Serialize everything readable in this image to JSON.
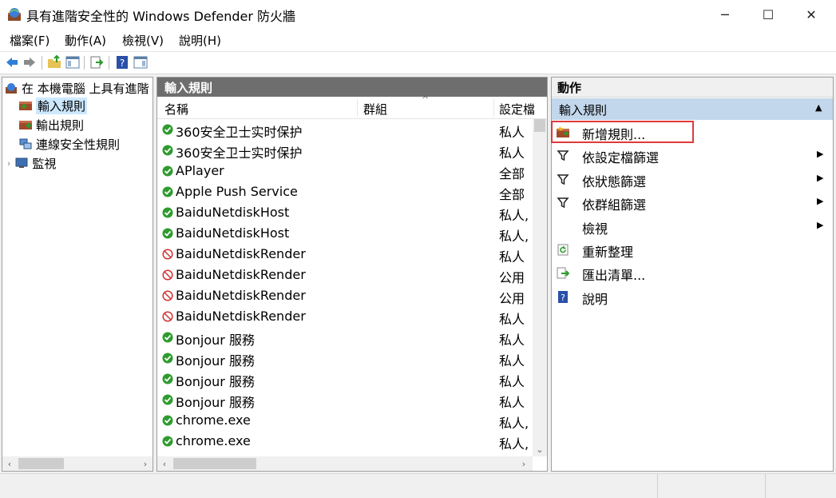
{
  "window": {
    "title": "具有進階安全性的 Windows Defender 防火牆",
    "minimize": "─",
    "maximize": "☐",
    "close": "✕"
  },
  "menu": [
    "檔案(F)",
    "動作(A)",
    "檢視(V)",
    "說明(H)"
  ],
  "tree": {
    "root": "在 本機電腦 上具有進階",
    "items": [
      "輸入規則",
      "輸出規則",
      "連線安全性規則",
      "監視"
    ]
  },
  "middle": {
    "header": "輸入規則",
    "columns": [
      "名稱",
      "群組",
      "設定檔"
    ],
    "rows": [
      {
        "name": "360安全卫士实时保护",
        "profile": "私人",
        "status": "allow"
      },
      {
        "name": "360安全卫士实时保护",
        "profile": "私人",
        "status": "allow"
      },
      {
        "name": "APlayer",
        "profile": "全部",
        "status": "allow"
      },
      {
        "name": "Apple Push Service",
        "profile": "全部",
        "status": "allow"
      },
      {
        "name": "BaiduNetdiskHost",
        "profile": "私人,",
        "status": "allow"
      },
      {
        "name": "BaiduNetdiskHost",
        "profile": "私人,",
        "status": "allow"
      },
      {
        "name": "BaiduNetdiskRender",
        "profile": "私人",
        "status": "block"
      },
      {
        "name": "BaiduNetdiskRender",
        "profile": "公用",
        "status": "block"
      },
      {
        "name": "BaiduNetdiskRender",
        "profile": "公用",
        "status": "block"
      },
      {
        "name": "BaiduNetdiskRender",
        "profile": "私人",
        "status": "block"
      },
      {
        "name": "Bonjour 服務",
        "profile": "私人",
        "status": "allow"
      },
      {
        "name": "Bonjour 服務",
        "profile": "私人",
        "status": "allow"
      },
      {
        "name": "Bonjour 服務",
        "profile": "私人",
        "status": "allow"
      },
      {
        "name": "Bonjour 服務",
        "profile": "私人",
        "status": "allow"
      },
      {
        "name": "chrome.exe",
        "profile": "私人,",
        "status": "allow"
      },
      {
        "name": "chrome.exe",
        "profile": "私人,",
        "status": "allow"
      }
    ]
  },
  "actions": {
    "header": "動作",
    "section": "輸入規則",
    "items": [
      {
        "label": "新增規則...",
        "icon": "new-rule-icon",
        "arrow": false
      },
      {
        "label": "依設定檔篩選",
        "icon": "filter-icon",
        "arrow": true
      },
      {
        "label": "依狀態篩選",
        "icon": "filter-icon",
        "arrow": true
      },
      {
        "label": "依群組篩選",
        "icon": "filter-icon",
        "arrow": true
      },
      {
        "label": "檢視",
        "icon": "",
        "arrow": true
      },
      {
        "label": "重新整理",
        "icon": "refresh-icon",
        "arrow": false
      },
      {
        "label": "匯出清單...",
        "icon": "export-icon",
        "arrow": false
      },
      {
        "label": "說明",
        "icon": "help-icon",
        "arrow": false
      }
    ]
  },
  "colors": {
    "allow": "#2e9b2e",
    "block": "#d03030",
    "highlight": "#e03a3a",
    "section": "#c2d6ec"
  }
}
